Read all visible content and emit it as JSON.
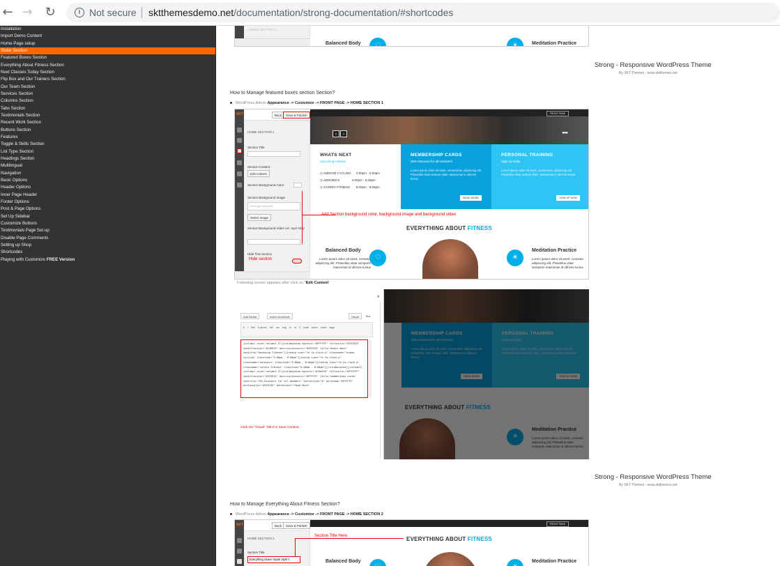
{
  "browser": {
    "not_secure": "Not secure",
    "url_domain": "sktthemesdemo.net",
    "url_path": "/documentation/strong-documentation/#shortcodes"
  },
  "sidebar": {
    "items": [
      {
        "label": "Installation"
      },
      {
        "label": "Import Demo Content"
      },
      {
        "label": "Home Page setup"
      },
      {
        "label": "Slider Section",
        "active": true
      },
      {
        "label": "Featured Boxes Section"
      },
      {
        "label": "Everything About Fitness Section"
      },
      {
        "label": "Next Classes Today Section"
      },
      {
        "label": "Flip Box and Our Trainers Section"
      },
      {
        "label": "Our Team Section"
      },
      {
        "label": "Services Section"
      },
      {
        "label": "Columns Section"
      },
      {
        "label": "Tabs Section"
      },
      {
        "label": "Testimonials Section"
      },
      {
        "label": "Recent Work Section"
      },
      {
        "label": "Buttons Section"
      },
      {
        "label": "Features"
      },
      {
        "label": "Toggle & Skills Section"
      },
      {
        "label": "List Type Section"
      },
      {
        "label": "Headings Section"
      },
      {
        "label": "Multilingual"
      },
      {
        "label": "Navigation"
      },
      {
        "label": "Basic Options"
      },
      {
        "label": "Header Options"
      },
      {
        "label": "Inner Page Header"
      },
      {
        "label": "Footer Options"
      },
      {
        "label": "Post & Page Options"
      },
      {
        "label": "Set Up Sidebar"
      },
      {
        "label": "Customize Buttons"
      },
      {
        "label": "Testimonials Page Set up"
      },
      {
        "label": "Disable Page Comments"
      },
      {
        "label": "Setting up Shop"
      },
      {
        "label": "Shortcodes"
      },
      {
        "label": "Playing with Customize ",
        "bold": "FREE Version"
      }
    ]
  },
  "content": {
    "theme_title": "Strong - Responsive WordPress Theme",
    "theme_sub": "By SKT Themes - www.sktthemes.net",
    "q1": "How to Manage featured boxes section Section?",
    "q1_path_prefix": "WordPress Admin ",
    "q1_path": "Appearance -> Customize -> FRONT PAGE -> HOME SECTION 1",
    "caption_prefix": "Following screen appears after click on \"",
    "caption_bold": "Edit Content",
    "caption_suffix": "\"",
    "q2": "How to Manage Everything About Fitness Section?",
    "q2_path_prefix": "WordPress Admin ",
    "q2_path": "Appearance -> Customize -> FRONT PAGE -> HOME SECTION 2"
  },
  "shot_top": {
    "label_partial": "< HOME SECTION 1",
    "balanced": "Balanced Body",
    "meditation": "Meditation Practice"
  },
  "shot1": {
    "back": "Back",
    "save": "Save & Publish",
    "section_name": "HOME SECTION 1",
    "section_title": "Section Title",
    "section_content": "Section Content",
    "edit_content": "Edit content",
    "bg_color": "Section Background Color",
    "bg_image": "Section Background Image",
    "no_image": "No image selected",
    "select_image": "Select image",
    "bg_video": "Section Background Video Url .mp4 Only",
    "hide_this": "Hide This Section",
    "hide_section": "Hide section",
    "red_note": "Add Section background color, background image and background video",
    "front_page_pill": "FRONT PAGE",
    "whats_next": "WHATS NEXT",
    "upcoming": "Upcoming Classes",
    "class1": "INDOOR CYCLING",
    "time1": "2:00pm - 6:00pm",
    "class2": "AEROBICS",
    "time2": "4:00pm - 6:00pm",
    "class3": "CARDIO FITNESS",
    "time3": "6:00pm - 8:00pm",
    "membership": "MEMBERSHIP CARDS",
    "membership_sub": "25% Discount for all members",
    "lorem": "Lorem ipsum dolor sit amet, consectetur adipiscing elit. Phasellus vitae semper diam. Maecenas in ultrices luctus.",
    "read_more": "READ MORE",
    "personal": "PERSONAL TRAINING",
    "personal_sub": "Sign up today",
    "sign_up": "SIGN UP NOW",
    "everything": "EVERYTHING ABOUT ",
    "fitness": "FITNESS",
    "balanced": "Balanced Body",
    "balanced_txt": "Lorem ipsum dolor sit amet, consetur adipiscing elit. Phasellus vitae semperin maecenas id ultrices luctus",
    "meditation": "Meditation Practice",
    "meditation_txt": "Lorem ipsum dolor sit amet, consetur adipiscing elit. Phasellus vitae semperin maecenas id ultrices luctus"
  },
  "shot2": {
    "add_media": "Add Media",
    "insert_shortcode": "Insert shortcode",
    "visual": "Visual",
    "text": "Text",
    "tools": "b   i   link   b-quote   del   ins   img   ul   ol   li   code   more   close tags",
    "code": "[column1 size=\"column1-3\"][infoboxarea bgcolor=\"#FFFFFF\" titlecolor=\"#333333\" subtitlecolor=\"#13b9f6\" descriptioncolor=\"#333333\" title=\"Whats Next\" subtitle=\"Upcoming Classes\"][timing icon=\"fa fa-clock-o\" classname=\"indoor cycling\" classtime=\"2:00pm - 6:00pm\"][timing icon=\"fa fa-clock-o\" classname=\"aerobics\" classtime=\"4:00pm - 6:00pm\"][timing icon=\"fa fa-clock-o\" classname=\"cardio fitness\" classtime=\"6:00pm - 8:00pm\"][/infoboxarea][/column1][column1 size=\"column1-3\"][infoboxarea bgcolor=\"#13b9f6\" titlecolor=\"#FFFFFF\" subtitlecolor=\"#333333\" descriptioncolor=\"#FFFFFF\" title=\"membership cards\" subtitle=\"25% Discount for all members\" buttonlink=\"#\" buttonbg=\"#FFFFFF\" buttoncolor=\"#333333\" buttontext=\"Read More\"",
    "red_caption": "Click On \"Visual\" Tab For Save Content.",
    "close": "×"
  },
  "shot3": {
    "back": "Back",
    "save": "Save & Publish",
    "section_name": "HOME SECTION 2",
    "section_title": "Section Title",
    "field_value": "Everything About <span style\"c",
    "red_note": "Section Title Here",
    "everything": "EVERYTHING ABOUT ",
    "fitness": "FITNESS",
    "balanced": "Balanced Body",
    "meditation": "Meditation Practice",
    "front_page_pill": "FRONT PAGE"
  },
  "colors": {
    "sidebar_bg": "#333333",
    "active_item": "#ff6600",
    "accent_blue": "#00aee8",
    "box_blue": "#0aa2dc",
    "box_light_blue": "#2ec5f4",
    "annotation_red": "#e00000"
  },
  "icons": [
    "back-arrow-icon",
    "forward-arrow-icon",
    "reload-icon",
    "info-icon",
    "heart-icon",
    "meditation-icon"
  ]
}
